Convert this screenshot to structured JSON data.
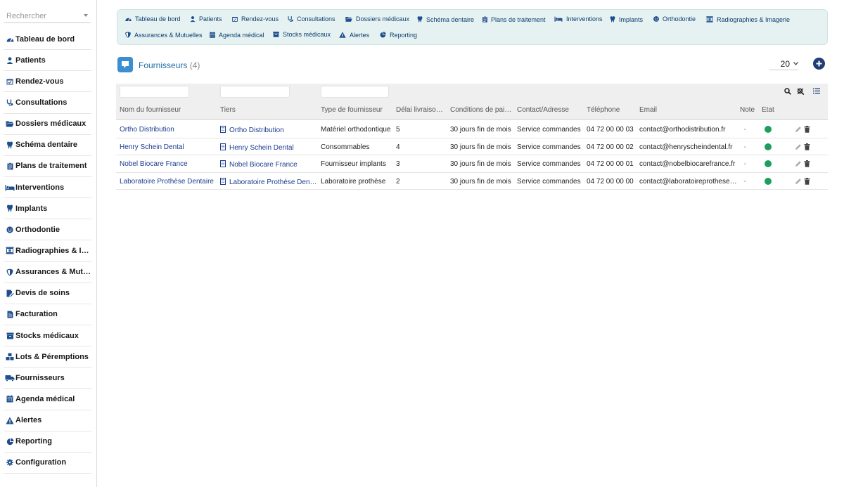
{
  "search": {
    "placeholder": "Rechercher"
  },
  "sidebar": {
    "items": [
      {
        "label": "Tableau de bord",
        "icon": "dashboard-icon"
      },
      {
        "label": "Patients",
        "icon": "user-icon"
      },
      {
        "label": "Rendez-vous",
        "icon": "calendar-check-icon"
      },
      {
        "label": "Consultations",
        "icon": "stethoscope-icon"
      },
      {
        "label": "Dossiers médicaux",
        "icon": "folder-open-icon"
      },
      {
        "label": "Schéma dentaire",
        "icon": "tooth-icon"
      },
      {
        "label": "Plans de traitement",
        "icon": "clipboard-icon"
      },
      {
        "label": "Interventions",
        "icon": "bed-icon"
      },
      {
        "label": "Implants",
        "icon": "tooth-icon"
      },
      {
        "label": "Orthodontie",
        "icon": "smile-icon"
      },
      {
        "label": "Radiographies & Imagerie",
        "icon": "xray-icon"
      },
      {
        "label": "Assurances & Mutuelles",
        "icon": "shield-icon"
      },
      {
        "label": "Devis de soins",
        "icon": "file-edit-icon"
      },
      {
        "label": "Facturation",
        "icon": "invoice-icon"
      },
      {
        "label": "Stocks médicaux",
        "icon": "box-icon"
      },
      {
        "label": "Lots & Péremptions",
        "icon": "boxes-icon"
      },
      {
        "label": "Fournisseurs",
        "icon": "truck-icon"
      },
      {
        "label": "Agenda médical",
        "icon": "calendar-icon"
      },
      {
        "label": "Alertes",
        "icon": "warning-icon"
      },
      {
        "label": "Reporting",
        "icon": "pie-chart-icon"
      },
      {
        "label": "Configuration",
        "icon": "gear-icon"
      }
    ]
  },
  "topnav": {
    "items": [
      {
        "label": "Tableau de bord"
      },
      {
        "label": "Patients"
      },
      {
        "label": "Rendez-vous"
      },
      {
        "label": "Consultations"
      },
      {
        "label": "Dossiers médicaux"
      },
      {
        "label": "Schéma dentaire"
      },
      {
        "label": "Plans de traitement"
      },
      {
        "label": "Interventions"
      },
      {
        "label": "Implants"
      },
      {
        "label": "Orthodontie"
      },
      {
        "label": "Radiographies & Imagerie"
      },
      {
        "label": "Assurances & Mutuelles"
      },
      {
        "label": "Agenda médical"
      },
      {
        "label": "Stocks médicaux"
      },
      {
        "label": "Alertes"
      },
      {
        "label": "Reporting"
      }
    ]
  },
  "page": {
    "title": "Fournisseurs",
    "count": "(4)",
    "page_size": "20"
  },
  "table": {
    "headers": [
      "Nom du fournisseur",
      "Tiers",
      "Type de fournisseur",
      "Délai livraison (jours)",
      "Conditions de paiement",
      "Contact/Adresse",
      "Téléphone",
      "Email",
      "Note",
      "État"
    ],
    "rows": [
      {
        "name": "Ortho Distribution",
        "tiers": "Ortho Distribution",
        "type": "Matériel orthodontique",
        "delay": "5",
        "conditions": "30 jours fin de mois",
        "contact": "Service commandes",
        "phone": "04 72 00 00 03",
        "email": "contact@orthodistribution.fr",
        "note": "-",
        "status": "active"
      },
      {
        "name": "Henry Schein Dental",
        "tiers": "Henry Schein Dental",
        "type": "Consommables",
        "delay": "4",
        "conditions": "30 jours fin de mois",
        "contact": "Service commandes",
        "phone": "04 72 00 00 02",
        "email": "contact@henryscheindental.fr",
        "note": "-",
        "status": "active"
      },
      {
        "name": "Nobel Biocare France",
        "tiers": "Nobel Biocare France",
        "type": "Fournisseur implants",
        "delay": "3",
        "conditions": "30 jours fin de mois",
        "contact": "Service commandes",
        "phone": "04 72 00 00 01",
        "email": "contact@nobelbiocarefrance.fr",
        "note": "-",
        "status": "active"
      },
      {
        "name": "Laboratoire Prothèse Dentaire",
        "tiers": "Laboratoire Prothèse Dentaire",
        "type": "Laboratoire prothèse",
        "delay": "2",
        "conditions": "30 jours fin de mois",
        "contact": "Service commandes",
        "phone": "04 72 00 00 00",
        "email": "contact@laboratoireprothesedentaire.fr",
        "note": "-",
        "status": "active"
      }
    ]
  },
  "colors": {
    "accent": "#1f3e75",
    "link": "#1b3d8f",
    "status_active": "#1e9e5c",
    "nav_bg": "#e6f2f2"
  }
}
